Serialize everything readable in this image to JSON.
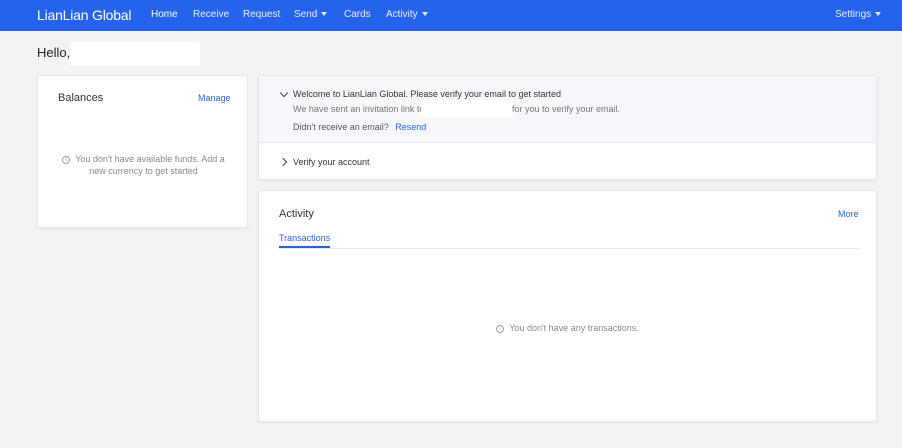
{
  "nav": {
    "logo": "LianLian Global",
    "items": [
      {
        "label": "Home",
        "active": true
      },
      {
        "label": "Receive"
      },
      {
        "label": "Request"
      },
      {
        "label": "Send",
        "dropdown": true
      },
      {
        "label": "Cards"
      },
      {
        "label": "Activity",
        "dropdown": true
      }
    ],
    "settings": "Settings"
  },
  "greeting": "Hello,",
  "balances": {
    "title": "Balances",
    "manage": "Manage",
    "empty": "You don't have available funds. Add a new currency to get started"
  },
  "verify": {
    "title": "Welcome to LianLian Global. Please verify your email to get started",
    "sent_prefix": "We have sent an invitation link to",
    "sent_suffix": "for you to verify your email.",
    "not_received": "Didn't receive an email?",
    "resend": "Resend",
    "account": "Verify your account"
  },
  "activity": {
    "title": "Activity",
    "more": "More",
    "tab": "Transactions",
    "empty": "You don't have any transactions."
  },
  "colors": {
    "primary": "#2563eb",
    "link": "#2a62d6",
    "background": "#f2f3f5"
  },
  "icons": {
    "info": "info-icon",
    "chevron_down": "chevron-down-icon",
    "chevron_right": "chevron-right-icon",
    "caret": "caret-down-icon"
  }
}
